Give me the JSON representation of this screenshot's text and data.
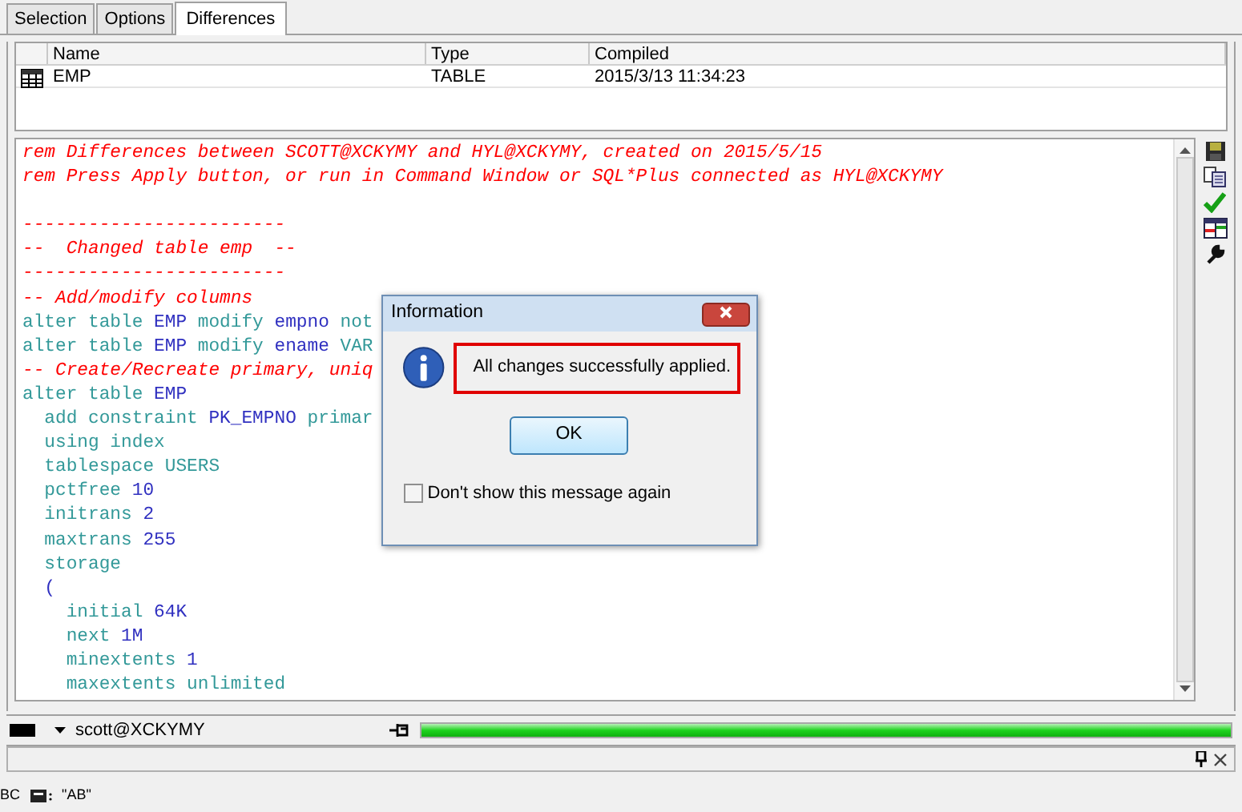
{
  "tabs": [
    {
      "label": "Selection",
      "selected": false
    },
    {
      "label": "Options",
      "selected": false
    },
    {
      "label": "Differences",
      "selected": true
    }
  ],
  "objects_table": {
    "columns": [
      "Name",
      "Type",
      "Compiled"
    ],
    "rows": [
      {
        "cells": [
          "EMP",
          "TABLE",
          "2015/3/13 11:34:23"
        ]
      }
    ]
  },
  "script_blocks": [
    [
      [
        {
          "text": "rem Differences between SCOTT@XCKYMY and HYL@XCKYMY, created on 2015/5/15",
          "kind": "comment"
        }
      ],
      [
        {
          "text": "rem Press Apply button, or run in Command Window or SQL*Plus connected as HYL@XCKYMY",
          "kind": "comment"
        }
      ]
    ],
    [
      [
        {
          "text": "------------------------",
          "kind": "comment"
        }
      ],
      [
        {
          "text": "--  Changed table emp  --",
          "kind": "comment"
        }
      ],
      [
        {
          "text": "------------------------",
          "kind": "comment"
        }
      ],
      [
        {
          "text": "-- Add/modify columns",
          "kind": "comment"
        }
      ],
      [
        {
          "text": "alter table ",
          "kind": "keyword"
        },
        {
          "text": "EMP",
          "kind": "name"
        },
        {
          "text": " modify ",
          "kind": "keyword"
        },
        {
          "text": "empno",
          "kind": "name"
        },
        {
          "text": " not",
          "kind": "keyword"
        }
      ],
      [
        {
          "text": "alter table ",
          "kind": "keyword"
        },
        {
          "text": "EMP",
          "kind": "name"
        },
        {
          "text": " modify ",
          "kind": "keyword"
        },
        {
          "text": "ename",
          "kind": "name"
        },
        {
          "text": " VAR",
          "kind": "keyword"
        }
      ],
      [
        {
          "text": "-- Create/Recreate primary, uniq",
          "kind": "comment"
        }
      ],
      [
        {
          "text": "alter table ",
          "kind": "keyword"
        },
        {
          "text": "EMP",
          "kind": "name"
        }
      ],
      [
        {
          "text": "  add constraint ",
          "kind": "keyword"
        },
        {
          "text": "PK_EMPNO",
          "kind": "name"
        },
        {
          "text": " primar",
          "kind": "keyword"
        }
      ],
      [
        {
          "text": "  using index",
          "kind": "keyword"
        }
      ],
      [
        {
          "text": "  tablespace USERS",
          "kind": "keyword"
        }
      ],
      [
        {
          "text": "  pctfree ",
          "kind": "keyword"
        },
        {
          "text": "10",
          "kind": "name"
        }
      ],
      [
        {
          "text": "  initrans ",
          "kind": "keyword"
        },
        {
          "text": "2",
          "kind": "name"
        }
      ],
      [
        {
          "text": "  maxtrans ",
          "kind": "keyword"
        },
        {
          "text": "255",
          "kind": "name"
        }
      ],
      [
        {
          "text": "  storage",
          "kind": "keyword"
        }
      ],
      [
        {
          "text": "  (",
          "kind": "name"
        }
      ],
      [
        {
          "text": "    initial ",
          "kind": "keyword"
        },
        {
          "text": "64K",
          "kind": "name"
        }
      ],
      [
        {
          "text": "    next ",
          "kind": "keyword"
        },
        {
          "text": "1M",
          "kind": "name"
        }
      ],
      [
        {
          "text": "    minextents ",
          "kind": "keyword"
        },
        {
          "text": "1",
          "kind": "name"
        }
      ],
      [
        {
          "text": "    maxextents unlimited",
          "kind": "keyword"
        }
      ]
    ]
  ],
  "dialog": {
    "title": "Information",
    "message": "All changes successfully applied.",
    "button": "OK",
    "checkbox": {
      "label": "Don't show this message again",
      "checked": false
    }
  },
  "status_bar": {
    "connection": "scott@XCKYMY",
    "progress": {
      "level": 1
    }
  },
  "output_bar": {
    "texts": [
      "BC",
      "\"AB\""
    ]
  }
}
